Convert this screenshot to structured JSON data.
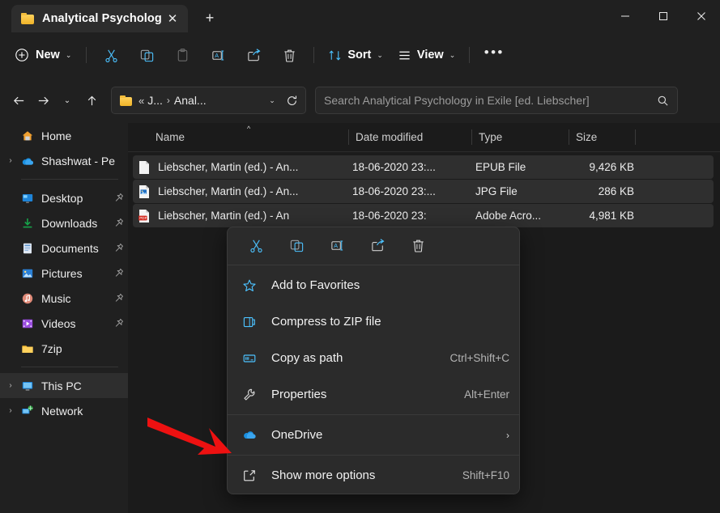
{
  "window": {
    "tab_title": "Analytical Psychology in Exile [ed. Liebscher]",
    "tab_close_label": "✕",
    "new_tab_label": "+",
    "minimize_label": "Minimize",
    "maximize_label": "Maximize",
    "close_label": "Close"
  },
  "toolbar": {
    "new_label": "New",
    "new_chevron": "⌄",
    "cut_label": "Cut",
    "copy_label": "Copy",
    "paste_label": "Paste",
    "rename_label": "Rename",
    "share_label": "Share",
    "delete_label": "Delete",
    "sort_label": "Sort",
    "sort_chevron": "⌄",
    "view_label": "View",
    "view_chevron": "⌄",
    "more_label": "See more"
  },
  "address": {
    "back_label": "Back",
    "forward_label": "Forward",
    "recent_chevron": "⌄",
    "up_label": "Up",
    "crumb_overflow": "«",
    "crumb_1": "J...",
    "crumb_separator": "›",
    "crumb_2": "Anal...",
    "dropdown_chevron": "⌄",
    "refresh_label": "Refresh"
  },
  "search": {
    "placeholder": "Search Analytical Psychology in Exile [ed. Liebscher]"
  },
  "sidebar": {
    "items": [
      {
        "label": "Home",
        "icon": "home-icon",
        "expander": "",
        "pinned": false,
        "selected": false
      },
      {
        "label": "Shashwat - Pe",
        "icon": "onedrive-icon",
        "expander": "›",
        "pinned": false,
        "selected": false
      },
      {
        "label": "Desktop",
        "icon": "desktop-icon",
        "expander": "",
        "pinned": true,
        "selected": false
      },
      {
        "label": "Downloads",
        "icon": "downloads-icon",
        "expander": "",
        "pinned": true,
        "selected": false
      },
      {
        "label": "Documents",
        "icon": "documents-icon",
        "expander": "",
        "pinned": true,
        "selected": false
      },
      {
        "label": "Pictures",
        "icon": "pictures-icon",
        "expander": "",
        "pinned": true,
        "selected": false
      },
      {
        "label": "Music",
        "icon": "music-icon",
        "expander": "",
        "pinned": true,
        "selected": false
      },
      {
        "label": "Videos",
        "icon": "videos-icon",
        "expander": "",
        "pinned": true,
        "selected": false
      },
      {
        "label": "7zip",
        "icon": "folder-icon",
        "expander": "",
        "pinned": false,
        "selected": false
      },
      {
        "label": "This PC",
        "icon": "thispc-icon",
        "expander": "›",
        "pinned": false,
        "selected": true
      },
      {
        "label": "Network",
        "icon": "network-icon",
        "expander": "›",
        "pinned": false,
        "selected": false
      }
    ]
  },
  "filelist": {
    "columns": {
      "name": "Name",
      "date_modified": "Date modified",
      "type": "Type",
      "size": "Size"
    },
    "sort_indicator": "^",
    "rows": [
      {
        "name": "Liebscher, Martin (ed.) - An...",
        "date": "18-06-2020 23:...",
        "type": "EPUB File",
        "size": "9,426 KB",
        "icon": "epub-file-icon",
        "selected": true
      },
      {
        "name": "Liebscher, Martin (ed.) - An...",
        "date": "18-06-2020 23:...",
        "type": "JPG File",
        "size": "286 KB",
        "icon": "jpg-file-icon",
        "selected": true
      },
      {
        "name": "Liebscher, Martin (ed.) - An",
        "date": "18-06-2020 23:",
        "type": "Adobe Acro...",
        "size": "4,981 KB",
        "icon": "pdf-file-icon",
        "selected": true
      }
    ]
  },
  "context_menu": {
    "toolbar": {
      "cut": "Cut",
      "copy": "Copy",
      "rename": "Rename",
      "share": "Share",
      "delete": "Delete"
    },
    "items": [
      {
        "label": "Add to Favorites",
        "accel": "",
        "submenu": "",
        "icon": "star-icon"
      },
      {
        "label": "Compress to ZIP file",
        "accel": "",
        "submenu": "",
        "icon": "zip-icon"
      },
      {
        "label": "Copy as path",
        "accel": "Ctrl+Shift+C",
        "submenu": "",
        "icon": "copy-path-icon"
      },
      {
        "label": "Properties",
        "accel": "Alt+Enter",
        "submenu": "",
        "icon": "wrench-icon"
      },
      {
        "label": "OneDrive",
        "accel": "",
        "submenu": "›",
        "icon": "onedrive-icon"
      },
      {
        "label": "Show more options",
        "accel": "Shift+F10",
        "submenu": "",
        "icon": "show-more-icon"
      }
    ]
  },
  "colors": {
    "accent": "#4cc2ff",
    "annotation": "#ee1111",
    "window_bg": "#202020",
    "content_bg": "#1b1b1b",
    "menu_bg": "#2b2b2b"
  }
}
